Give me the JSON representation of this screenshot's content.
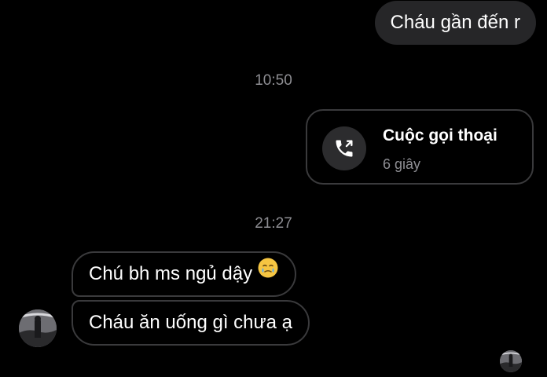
{
  "messages": {
    "outgoing_text": "Cháu gần đến r",
    "timestamp_1": "10:50",
    "call": {
      "title": "Cuộc gọi thoại",
      "duration": "6 giây",
      "icon": "outgoing-call-icon"
    },
    "timestamp_2": "21:27",
    "incoming_1": "Chú bh ms ngủ dậy",
    "incoming_1_emoji": "face-holding-back-tears-emoji",
    "incoming_2": "Cháu ăn uống gì chưa ạ"
  },
  "avatars": {
    "contact": "contact-avatar",
    "seen": "seen-receipt-avatar"
  },
  "colors": {
    "background": "#000000",
    "outgoing_bubble": "#262628",
    "bubble_border": "#3a3a3c",
    "secondary_text": "#8e8e93",
    "call_icon_bg": "#2c2c2e",
    "emoji_face": "#f5c542",
    "emoji_tear": "#4aa8ff"
  }
}
